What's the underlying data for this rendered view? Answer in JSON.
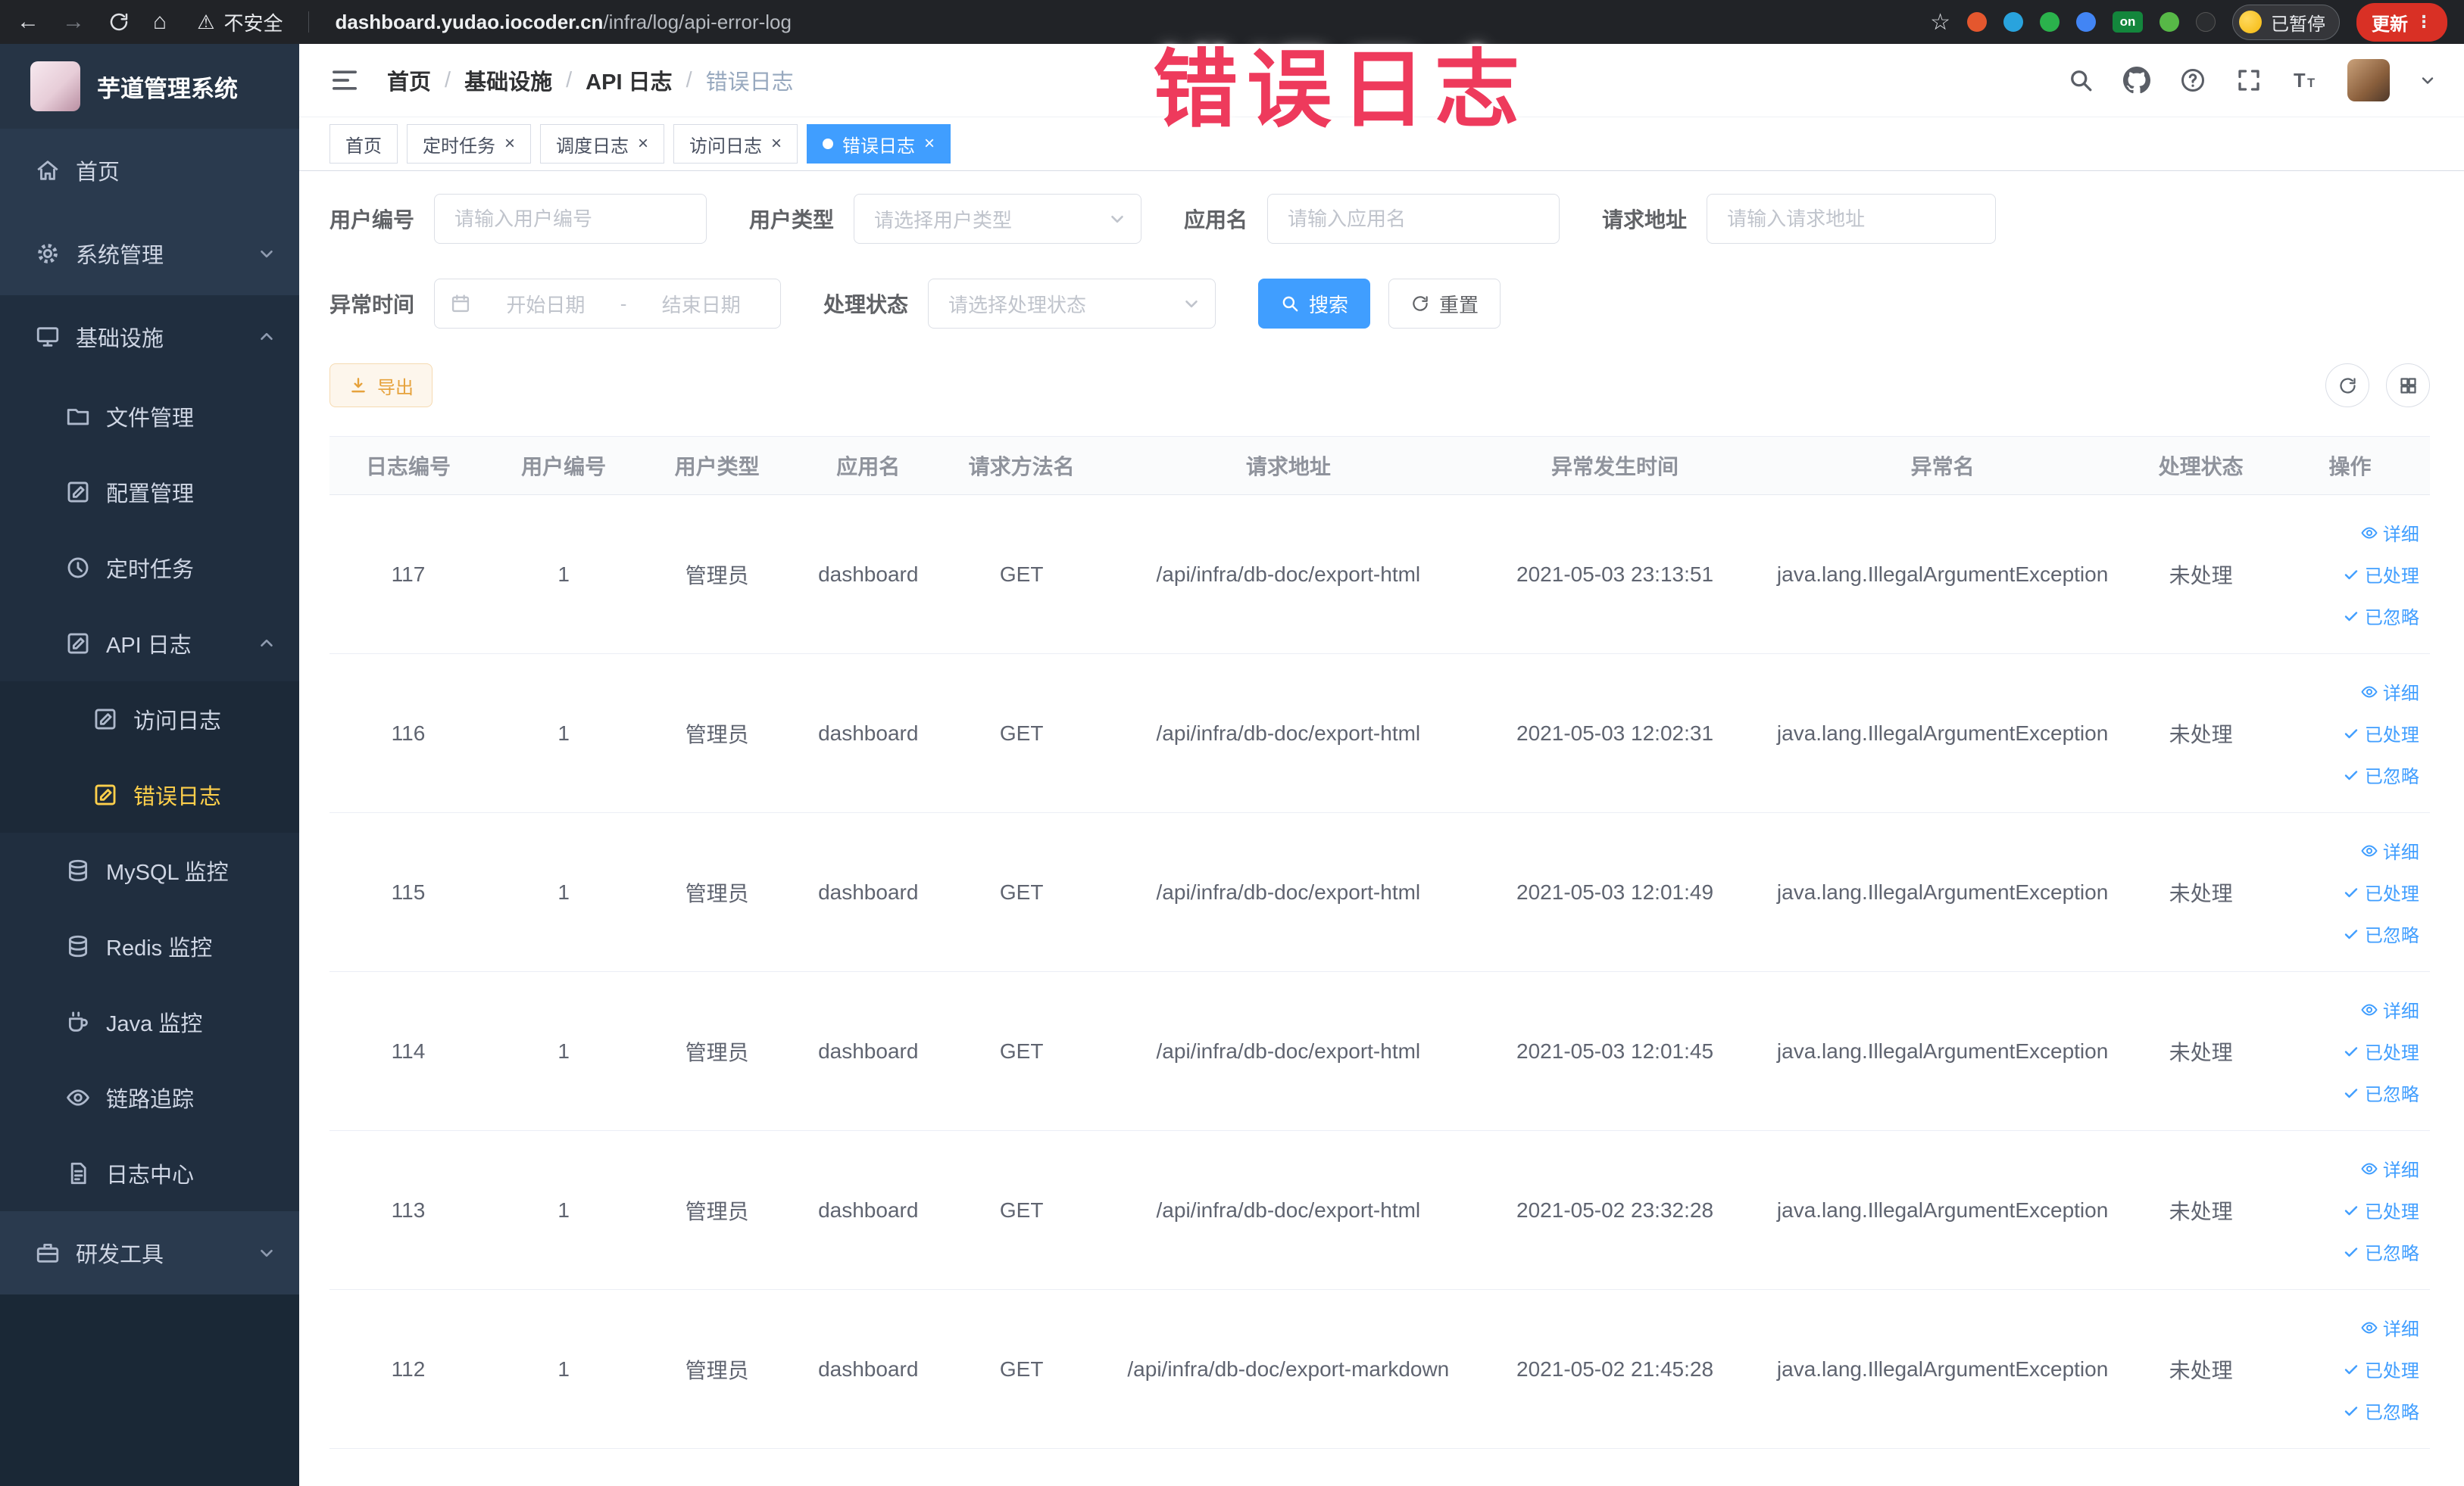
{
  "browser": {
    "security": "不安全",
    "url_domain": "dashboard.yudao.iocoder.cn",
    "url_path": "/infra/log/api-error-log",
    "extension_badge": "on",
    "profile_chip": "已暂停",
    "update_button": "更新"
  },
  "icons": {
    "back": "←",
    "forward": "→",
    "home": "⌂",
    "warning": "⚠",
    "star": "☆",
    "menu_dots": "⋮",
    "close": "×"
  },
  "annotation": "错误日志",
  "sidebar": {
    "title": "芋道管理系统",
    "items": [
      {
        "label": "首页"
      },
      {
        "label": "系统管理"
      },
      {
        "label": "基础设施"
      },
      {
        "label": "文件管理"
      },
      {
        "label": "配置管理"
      },
      {
        "label": "定时任务"
      },
      {
        "label": "API 日志"
      },
      {
        "label": "访问日志"
      },
      {
        "label": "错误日志"
      },
      {
        "label": "MySQL 监控"
      },
      {
        "label": "Redis 监控"
      },
      {
        "label": "Java 监控"
      },
      {
        "label": "链路追踪"
      },
      {
        "label": "日志中心"
      },
      {
        "label": "研发工具"
      }
    ]
  },
  "breadcrumb": [
    "首页",
    "基础设施",
    "API 日志",
    "错误日志"
  ],
  "breadcrumb_separator": "/",
  "tabs": [
    "首页",
    "定时任务",
    "调度日志",
    "访问日志",
    "错误日志"
  ],
  "filters": {
    "user_id": {
      "label": "用户编号",
      "placeholder": "请输入用户编号"
    },
    "user_type": {
      "label": "用户类型",
      "placeholder": "请选择用户类型"
    },
    "app_name": {
      "label": "应用名",
      "placeholder": "请输入应用名"
    },
    "request_url": {
      "label": "请求地址",
      "placeholder": "请输入请求地址"
    },
    "exception_time": {
      "label": "异常时间",
      "start_placeholder": "开始日期",
      "separator": "-",
      "end_placeholder": "结束日期"
    },
    "process_status": {
      "label": "处理状态",
      "placeholder": "请选择处理状态"
    },
    "search_label": "搜索",
    "reset_label": "重置"
  },
  "toolbar": {
    "export_label": "导出"
  },
  "table": {
    "columns": [
      "日志编号",
      "用户编号",
      "用户类型",
      "应用名",
      "请求方法名",
      "请求地址",
      "异常发生时间",
      "异常名",
      "处理状态",
      "操作"
    ],
    "actions": [
      "详细",
      "已处理",
      "已忽略"
    ],
    "rows": [
      {
        "id": "117",
        "user_id": "1",
        "user_type": "管理员",
        "app": "dashboard",
        "method": "GET",
        "url": "/api/infra/db-doc/export-html",
        "time": "2021-05-03 23:13:51",
        "exception": "java.lang.IllegalArgumentException",
        "status": "未处理"
      },
      {
        "id": "116",
        "user_id": "1",
        "user_type": "管理员",
        "app": "dashboard",
        "method": "GET",
        "url": "/api/infra/db-doc/export-html",
        "time": "2021-05-03 12:02:31",
        "exception": "java.lang.IllegalArgumentException",
        "status": "未处理"
      },
      {
        "id": "115",
        "user_id": "1",
        "user_type": "管理员",
        "app": "dashboard",
        "method": "GET",
        "url": "/api/infra/db-doc/export-html",
        "time": "2021-05-03 12:01:49",
        "exception": "java.lang.IllegalArgumentException",
        "status": "未处理"
      },
      {
        "id": "114",
        "user_id": "1",
        "user_type": "管理员",
        "app": "dashboard",
        "method": "GET",
        "url": "/api/infra/db-doc/export-html",
        "time": "2021-05-03 12:01:45",
        "exception": "java.lang.IllegalArgumentException",
        "status": "未处理"
      },
      {
        "id": "113",
        "user_id": "1",
        "user_type": "管理员",
        "app": "dashboard",
        "method": "GET",
        "url": "/api/infra/db-doc/export-html",
        "time": "2021-05-02 23:32:28",
        "exception": "java.lang.IllegalArgumentException",
        "status": "未处理"
      },
      {
        "id": "112",
        "user_id": "1",
        "user_type": "管理员",
        "app": "dashboard",
        "method": "GET",
        "url": "/api/infra/db-doc/export-markdown",
        "time": "2021-05-02 21:45:28",
        "exception": "java.lang.IllegalArgumentException",
        "status": "未处理"
      }
    ]
  }
}
